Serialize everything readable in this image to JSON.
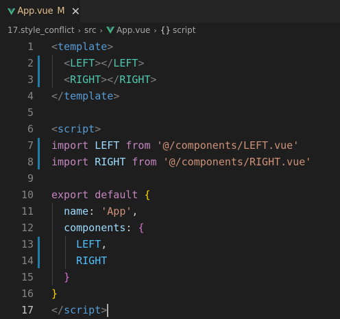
{
  "tab": {
    "filename": "App.vue",
    "modified_marker": "M",
    "close_glyph": "✕",
    "icon": "vue-icon"
  },
  "breadcrumb": {
    "folder": "17.style_conflict",
    "subfolder": "src",
    "file": "App.vue",
    "symbol_icon": "{}",
    "symbol": "script"
  },
  "editor": {
    "active_line": 17,
    "lines": [
      {
        "n": "1",
        "tokens": [
          [
            "t-tag",
            "<"
          ],
          [
            "t-name",
            "template"
          ],
          [
            "t-tag",
            ">"
          ]
        ]
      },
      {
        "n": "2",
        "tokens": [
          [
            "t-plain",
            "  "
          ],
          [
            "t-tag",
            "<"
          ],
          [
            "t-comp",
            "LEFT"
          ],
          [
            "t-tag",
            "></"
          ],
          [
            "t-comp",
            "LEFT"
          ],
          [
            "t-tag",
            ">"
          ]
        ]
      },
      {
        "n": "3",
        "tokens": [
          [
            "t-plain",
            "  "
          ],
          [
            "t-tag",
            "<"
          ],
          [
            "t-comp",
            "RIGHT"
          ],
          [
            "t-tag",
            "></"
          ],
          [
            "t-comp",
            "RIGHT"
          ],
          [
            "t-tag",
            ">"
          ]
        ]
      },
      {
        "n": "4",
        "tokens": [
          [
            "t-tag",
            "</"
          ],
          [
            "t-name",
            "template"
          ],
          [
            "t-tag",
            ">"
          ]
        ]
      },
      {
        "n": "5",
        "tokens": []
      },
      {
        "n": "6",
        "tokens": [
          [
            "t-tag",
            "<"
          ],
          [
            "t-name",
            "script"
          ],
          [
            "t-tag",
            ">"
          ]
        ]
      },
      {
        "n": "7",
        "tokens": [
          [
            "t-kw",
            "import"
          ],
          [
            "t-plain",
            " "
          ],
          [
            "t-id",
            "LEFT"
          ],
          [
            "t-plain",
            " "
          ],
          [
            "t-kw",
            "from"
          ],
          [
            "t-plain",
            " "
          ],
          [
            "t-str",
            "'@/components/LEFT.vue'"
          ]
        ]
      },
      {
        "n": "8",
        "tokens": [
          [
            "t-kw",
            "import"
          ],
          [
            "t-plain",
            " "
          ],
          [
            "t-id",
            "RIGHT"
          ],
          [
            "t-plain",
            " "
          ],
          [
            "t-kw",
            "from"
          ],
          [
            "t-plain",
            " "
          ],
          [
            "t-str",
            "'@/components/RIGHT.vue'"
          ]
        ]
      },
      {
        "n": "9",
        "tokens": []
      },
      {
        "n": "10",
        "tokens": [
          [
            "t-kw",
            "export"
          ],
          [
            "t-plain",
            " "
          ],
          [
            "t-kw",
            "default"
          ],
          [
            "t-plain",
            " "
          ],
          [
            "t-brace1",
            "{"
          ]
        ]
      },
      {
        "n": "11",
        "tokens": [
          [
            "t-plain",
            "  "
          ],
          [
            "t-id",
            "name"
          ],
          [
            "t-plain",
            ": "
          ],
          [
            "t-str",
            "'App'"
          ],
          [
            "t-plain",
            ","
          ]
        ]
      },
      {
        "n": "12",
        "tokens": [
          [
            "t-plain",
            "  "
          ],
          [
            "t-id",
            "components"
          ],
          [
            "t-plain",
            ": "
          ],
          [
            "t-brace2",
            "{"
          ]
        ]
      },
      {
        "n": "13",
        "tokens": [
          [
            "t-plain",
            "    "
          ],
          [
            "t-var",
            "LEFT"
          ],
          [
            "t-plain",
            ","
          ]
        ]
      },
      {
        "n": "14",
        "tokens": [
          [
            "t-plain",
            "    "
          ],
          [
            "t-var",
            "RIGHT"
          ]
        ]
      },
      {
        "n": "15",
        "tokens": [
          [
            "t-plain",
            "  "
          ],
          [
            "t-brace2",
            "}"
          ]
        ]
      },
      {
        "n": "16",
        "tokens": [
          [
            "t-brace1",
            "}"
          ]
        ]
      },
      {
        "n": "17",
        "tokens": [
          [
            "t-tag",
            "</"
          ],
          [
            "t-name",
            "script"
          ],
          [
            "t-tag",
            ">"
          ]
        ]
      }
    ]
  },
  "colors": {
    "background": "#1e1e1e",
    "tabbar": "#252526",
    "modified": "#e2c08d",
    "gutter_modified": "#1b81a8"
  }
}
